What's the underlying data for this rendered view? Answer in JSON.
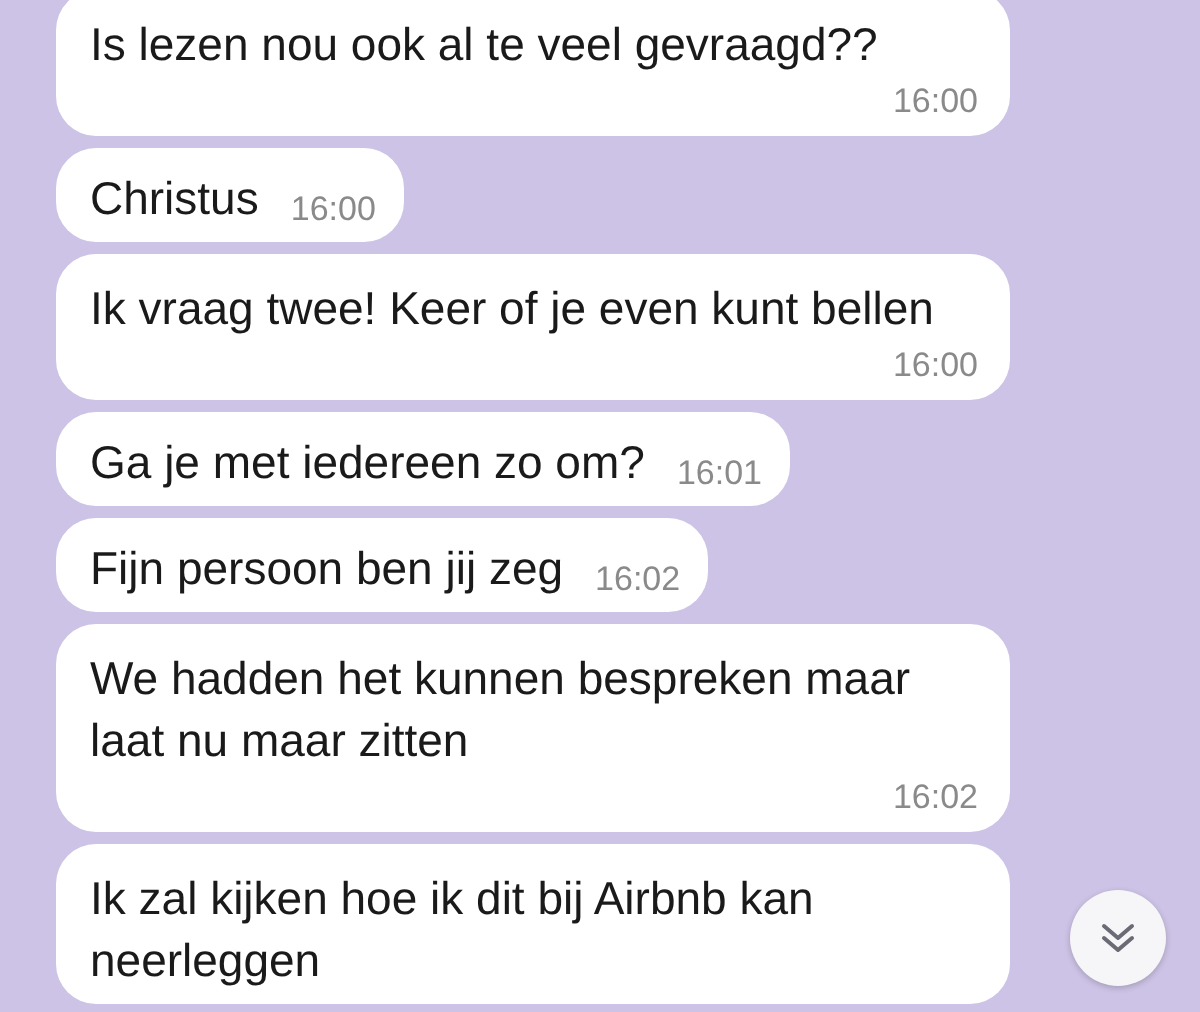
{
  "messages": [
    {
      "kind": "stacked",
      "text": "Is lezen nou ook al te veel gevraagd??",
      "time": "16:00"
    },
    {
      "kind": "inline",
      "text": "Christus",
      "time": "16:00"
    },
    {
      "kind": "stacked",
      "text": "Ik vraag twee! Keer of je even kunt bellen",
      "time": "16:00"
    },
    {
      "kind": "inline",
      "text": "Ga je met iedereen zo om?",
      "time": "16:01"
    },
    {
      "kind": "inline",
      "text": "Fijn persoon ben jij zeg",
      "time": "16:02"
    },
    {
      "kind": "stacked",
      "text": "We hadden het kunnen bespreken maar laat nu maar zitten",
      "time": "16:02"
    },
    {
      "kind": "stacked",
      "text": "Ik zal kijken hoe ik dit bij Airbnb kan neerleggen"
    }
  ]
}
